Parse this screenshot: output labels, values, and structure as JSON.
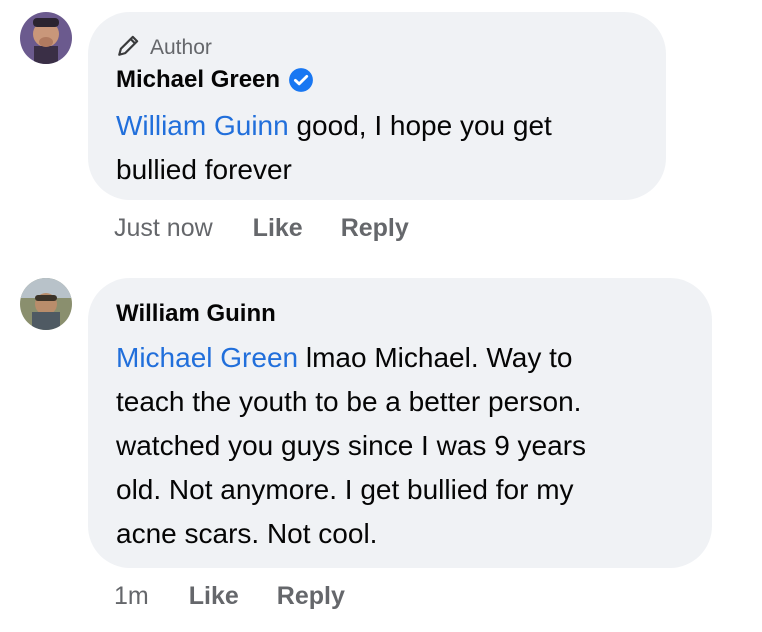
{
  "comments": [
    {
      "badge_label": "Author",
      "author": "Michael Green",
      "verified": true,
      "mention": "William Guinn",
      "text_lines": [
        " good, I hope you get",
        "bullied forever"
      ],
      "timestamp": "Just now",
      "like_label": "Like",
      "reply_label": "Reply"
    },
    {
      "author": "William Guinn",
      "mention": "Michael Green",
      "text_lines": [
        " lmao Michael. Way to",
        "teach the youth to be a better person.",
        "watched you guys since I was 9 years",
        "old. Not anymore. I get bullied for my",
        "acne scars. Not cool."
      ],
      "timestamp": "1m",
      "like_label": "Like",
      "reply_label": "Reply"
    }
  ],
  "colors": {
    "bubble": "#f0f2f5",
    "mention": "#216fdb",
    "secondary_text": "#65676b",
    "verified_badge": "#1877f2"
  }
}
